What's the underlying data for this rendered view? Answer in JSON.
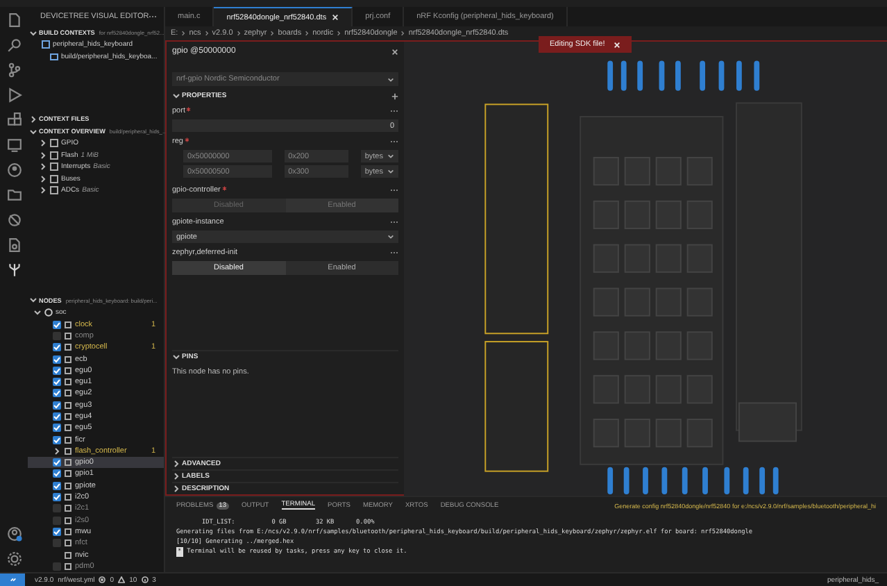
{
  "sidebar": {
    "title": "DEVICETREE VISUAL EDITOR",
    "build_contexts": {
      "title": "BUILD CONTEXTS",
      "hint": "for nrf52840dongle_nrf52...",
      "expanded": true,
      "items": [
        {
          "label": "peripheral_hids_keyboard",
          "children": [
            {
              "label": "build/peripheral_hids_keyboa..."
            }
          ]
        }
      ]
    },
    "context_files": {
      "title": "CONTEXT FILES",
      "expanded": false
    },
    "context_overview": {
      "title": "CONTEXT OVERVIEW",
      "hint": "build/peripheral_hids_...",
      "expanded": true,
      "items": [
        {
          "label": "GPIO"
        },
        {
          "label": "Flash",
          "hint": "1 MiB"
        },
        {
          "label": "Interrupts",
          "hint": "Basic"
        },
        {
          "label": "Buses"
        },
        {
          "label": "ADCs",
          "hint": "Basic"
        }
      ]
    },
    "nodes": {
      "title": "NODES",
      "hint": "peripheral_hids_keyboard: build/peri...",
      "expanded": true,
      "root": {
        "label": "soc",
        "expanded": true,
        "children": [
          {
            "label": "clock",
            "kind": "checkbox",
            "checked": true,
            "warning": true,
            "badge": "1",
            "selected": false
          },
          {
            "label": "comp",
            "kind": "checkbox",
            "checked": false,
            "warning": false,
            "selected": false
          },
          {
            "label": "cryptocell",
            "kind": "checkbox",
            "checked": true,
            "warning": true,
            "badge": "1",
            "selected": false
          },
          {
            "label": "ecb",
            "kind": "checkbox",
            "checked": true,
            "warning": false,
            "selected": false
          },
          {
            "label": "egu0",
            "kind": "checkbox",
            "checked": true,
            "warning": false,
            "selected": false
          },
          {
            "label": "egu1",
            "kind": "checkbox",
            "checked": true,
            "warning": false,
            "selected": false
          },
          {
            "label": "egu2",
            "kind": "checkbox",
            "checked": true,
            "warning": false,
            "selected": false
          },
          {
            "label": "egu3",
            "kind": "checkbox",
            "checked": true,
            "warning": false,
            "selected": false
          },
          {
            "label": "egu4",
            "kind": "checkbox",
            "checked": true,
            "warning": false,
            "selected": false
          },
          {
            "label": "egu5",
            "kind": "checkbox",
            "checked": true,
            "warning": false,
            "selected": false
          },
          {
            "label": "ficr",
            "kind": "checkbox",
            "checked": true,
            "warning": false,
            "selected": false
          },
          {
            "label": "flash_controller",
            "kind": "group",
            "expanded": false,
            "warning": true,
            "badge": "1",
            "selected": false
          },
          {
            "label": "gpio0",
            "kind": "checkbox",
            "checked": true,
            "warning": false,
            "selected": true
          },
          {
            "label": "gpio1",
            "kind": "checkbox",
            "checked": true,
            "warning": false,
            "selected": false
          },
          {
            "label": "gpiote",
            "kind": "checkbox",
            "checked": true,
            "warning": false,
            "selected": false
          },
          {
            "label": "i2c0",
            "kind": "checkbox",
            "checked": true,
            "warning": false,
            "selected": false
          },
          {
            "label": "i2c1",
            "kind": "checkbox",
            "checked": false,
            "warning": false,
            "selected": false
          },
          {
            "label": "i2s0",
            "kind": "checkbox",
            "checked": false,
            "warning": false,
            "selected": false
          },
          {
            "label": "mwu",
            "kind": "checkbox",
            "checked": true,
            "warning": false,
            "selected": false
          },
          {
            "label": "nfct",
            "kind": "checkbox",
            "checked": false,
            "warning": false,
            "selected": false
          },
          {
            "label": "nvic",
            "kind": "plain",
            "warning": false,
            "selected": false
          },
          {
            "label": "pdm0",
            "kind": "checkbox",
            "checked": false,
            "warning": false,
            "selected": false
          }
        ]
      }
    }
  },
  "tabs": [
    {
      "label": "main.c",
      "selected": false,
      "closable": false
    },
    {
      "label": "nrf52840dongle_nrf52840.dts",
      "selected": true,
      "closable": true
    },
    {
      "label": "prj.conf",
      "selected": false,
      "closable": false
    },
    {
      "label": "nRF Kconfig (peripheral_hids_keyboard)",
      "selected": false,
      "closable": false
    }
  ],
  "breadcrumb": [
    "E:",
    "ncs",
    "v2.9.0",
    "zephyr",
    "boards",
    "nordic",
    "nrf52840dongle",
    "nrf52840dongle_nrf52840.dts"
  ],
  "details": {
    "title": "gpio @50000000",
    "compatible": "nrf-gpio Nordic Semiconductor",
    "properties_title": "PROPERTIES",
    "properties": [
      {
        "kind": "number",
        "name": "port",
        "required": true,
        "value": "0"
      },
      {
        "kind": "reg",
        "name": "reg",
        "required": true,
        "rows": [
          {
            "address": "0x50000000",
            "size": "0x200",
            "unit": "bytes"
          },
          {
            "address": "0x50000500",
            "size": "0x300",
            "unit": "bytes"
          }
        ]
      },
      {
        "kind": "toggle",
        "name": "gpio-controller",
        "required": true,
        "disabled": true,
        "options": [
          {
            "label": "Disabled",
            "selected": false
          },
          {
            "label": "Enabled",
            "selected": true
          }
        ]
      },
      {
        "kind": "select",
        "name": "gpiote-instance",
        "required": false,
        "value": "gpiote"
      },
      {
        "kind": "toggle",
        "name": "zephyr,deferred-init",
        "required": false,
        "disabled": false,
        "options": [
          {
            "label": "Disabled",
            "selected": true
          },
          {
            "label": "Enabled",
            "selected": false
          }
        ]
      }
    ],
    "pins_title": "PINS",
    "pins_text": "This node has no pins.",
    "collapsed_sections": [
      "ADVANCED",
      "LABELS",
      "DESCRIPTION"
    ]
  },
  "canvas": {
    "banner": "Editing SDK file!"
  },
  "panel": {
    "tabs": [
      {
        "label": "PROBLEMS",
        "badge": "13",
        "selected": false
      },
      {
        "label": "OUTPUT",
        "selected": false
      },
      {
        "label": "TERMINAL",
        "selected": true
      },
      {
        "label": "PORTS",
        "selected": false
      },
      {
        "label": "MEMORY",
        "selected": false
      },
      {
        "label": "XRTOS",
        "selected": false
      },
      {
        "label": "DEBUG CONSOLE",
        "selected": false
      }
    ],
    "task": "Generate config nrf52840dongle/nrf52840 for e:/ncs/v2.9.0/nrf/samples/bluetooth/peripheral_hi",
    "terminal_lines": [
      "       IDT_LIST:          0 GB        32 KB      0.00%",
      "Generating files from E:/ncs/v2.9.0/nrf/samples/bluetooth/peripheral_hids_keyboard/build/peripheral_hids_keyboard/zephyr/zephyr.elf for board: nrf52840dongle",
      "[10/10] Generating ../merged.hex"
    ],
    "terminal_mark": "*",
    "terminal_notice": "Terminal will be reused by tasks, press any key to close it."
  },
  "status_bar": {
    "version": "v2.9.0",
    "manifest": "nrf/west.yml",
    "errors": "0",
    "warnings": "10",
    "infos": "3",
    "app": "peripheral_hids_"
  }
}
